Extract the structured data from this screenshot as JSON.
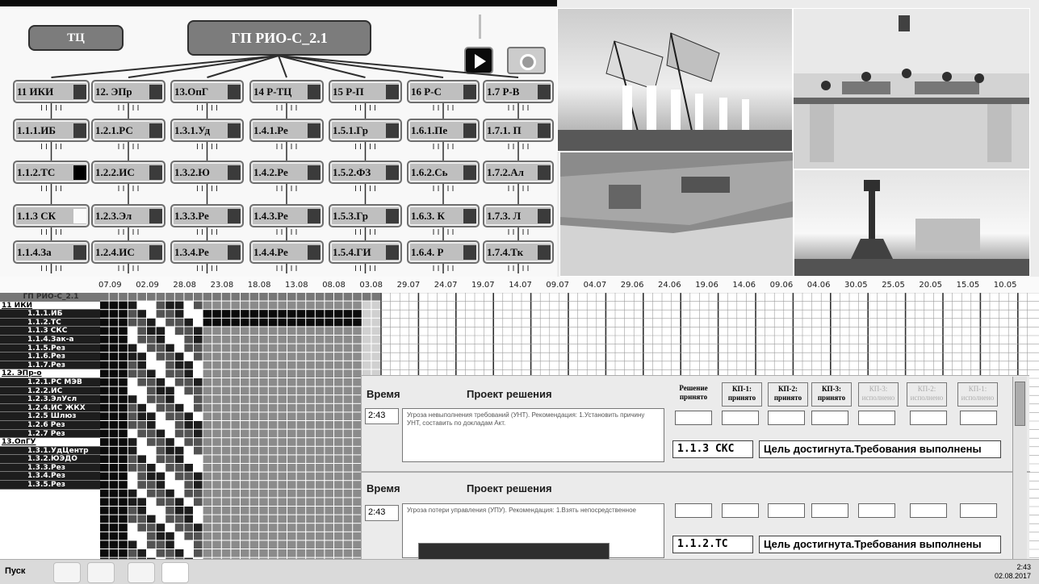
{
  "header": {
    "left_button": "ТЦ",
    "center_button": "ГП РИО-С_2.1"
  },
  "controls": {
    "play_icon": "play-icon",
    "power_icon": "power-icon"
  },
  "nodes": [
    [
      "11 ИКИ",
      "1.1.1.ИБ",
      "1.1.2.ТС",
      "1.1.3 СК",
      "1.1.4.За"
    ],
    [
      "12. ЭПр",
      "1.2.1.РС",
      "1.2.2.ИС",
      "1.2.3.Эл",
      "1.2.4.ИС"
    ],
    [
      "13.ОпГ",
      "1.3.1.Уд",
      "1.3.2.Ю",
      "1.3.3.Ре",
      "1.3.4.Ре"
    ],
    [
      "14 Р-ТЦ",
      "1.4.1.Ре",
      "1.4.2.Ре",
      "1.4.3.Ре",
      "1.4.4.Ре"
    ],
    [
      "15 Р-П",
      "1.5.1.Гр",
      "1.5.2.ФЗ",
      "1.5.3.Гр",
      "1.5.4.ГИ"
    ],
    [
      "16 Р-С",
      "1.6.1.Пе",
      "1.6.2.Сь",
      "1.6.3. К",
      "1.6.4. Р"
    ],
    [
      "1.7 Р-В",
      "1.7.1. П",
      "1.7.2.Ал",
      "1.7.3. Л",
      "1.7.4.Тк"
    ]
  ],
  "timeline": [
    "07.09",
    "02.09",
    "28.08",
    "23.08",
    "18.08",
    "13.08",
    "08.08",
    "03.08",
    "29.07",
    "24.07",
    "19.07",
    "14.07",
    "09.07",
    "04.07",
    "29.06",
    "24.06",
    "19.06",
    "14.06",
    "09.06",
    "04.06",
    "30.05",
    "25.05",
    "20.05",
    "15.05",
    "10.05"
  ],
  "tree": [
    {
      "label": "ГП РИО-С_2.1",
      "kind": "head"
    },
    {
      "label": "11 ИКИ",
      "kind": "grp"
    },
    {
      "label": "1.1.1.ИБ",
      "kind": "item"
    },
    {
      "label": "1.1.2.ТС",
      "kind": "item"
    },
    {
      "label": "1.1.3 СКС",
      "kind": "item"
    },
    {
      "label": "1.1.4.Зак-а",
      "kind": "item"
    },
    {
      "label": "1.1.5.Рез",
      "kind": "item"
    },
    {
      "label": "1.1.6.Рез",
      "kind": "item"
    },
    {
      "label": "1.1.7.Рез",
      "kind": "item"
    },
    {
      "label": "12. ЭПр-о",
      "kind": "grp"
    },
    {
      "label": "1.2.1.РС МЭВ",
      "kind": "item"
    },
    {
      "label": "1.2.2.ИС",
      "kind": "item"
    },
    {
      "label": "1.2.3.ЭлУсл",
      "kind": "item"
    },
    {
      "label": "1.2.4.ИС ЖКХ",
      "kind": "item"
    },
    {
      "label": "1.2.5 Шлюз",
      "kind": "item"
    },
    {
      "label": "1.2.6 Рез",
      "kind": "item"
    },
    {
      "label": "1.2.7 Рез",
      "kind": "item"
    },
    {
      "label": "13.ОпГУ",
      "kind": "grp"
    },
    {
      "label": "1.3.1.УдЦентр",
      "kind": "item"
    },
    {
      "label": "1.3.2.ЮЭДО",
      "kind": "item"
    },
    {
      "label": "1.3.3.Рез",
      "kind": "item"
    },
    {
      "label": "1.3.4.Рез",
      "kind": "item"
    },
    {
      "label": "1.3.5.Рез",
      "kind": "item"
    }
  ],
  "panel": {
    "time_label": "Время",
    "project_label": "Проект решения",
    "decision_label": "Решение принято",
    "kp_headers": [
      {
        "t": "КП-1: принято",
        "dim": false
      },
      {
        "t": "КП-2: принято",
        "dim": false
      },
      {
        "t": "КП-3: принято",
        "dim": false
      },
      {
        "t": "КП-3: исполнено",
        "dim": true
      },
      {
        "t": "КП-2: исполнено",
        "dim": true
      },
      {
        "t": "КП-1: исполнено",
        "dim": true
      }
    ],
    "rows": [
      {
        "time": "2:43",
        "message": "Угроза невыполнения требований (УНТ). Рекомендация: 1.Установить причину УНТ, составить по докладам Акт.",
        "code": "1.1.3 СКС",
        "status": "Цель достигнута.Требования выполнены"
      },
      {
        "time": "2:43",
        "message": "Угроза потери управления (УПУ). Рекомендация: 1.Взять непосредственное",
        "code": "1.1.2.ТС",
        "status": "Цель достигнута.Требования выполнены"
      }
    ]
  },
  "taskbar": {
    "start": "Пуск",
    "time": "2:43",
    "date": "02.08.2017"
  }
}
